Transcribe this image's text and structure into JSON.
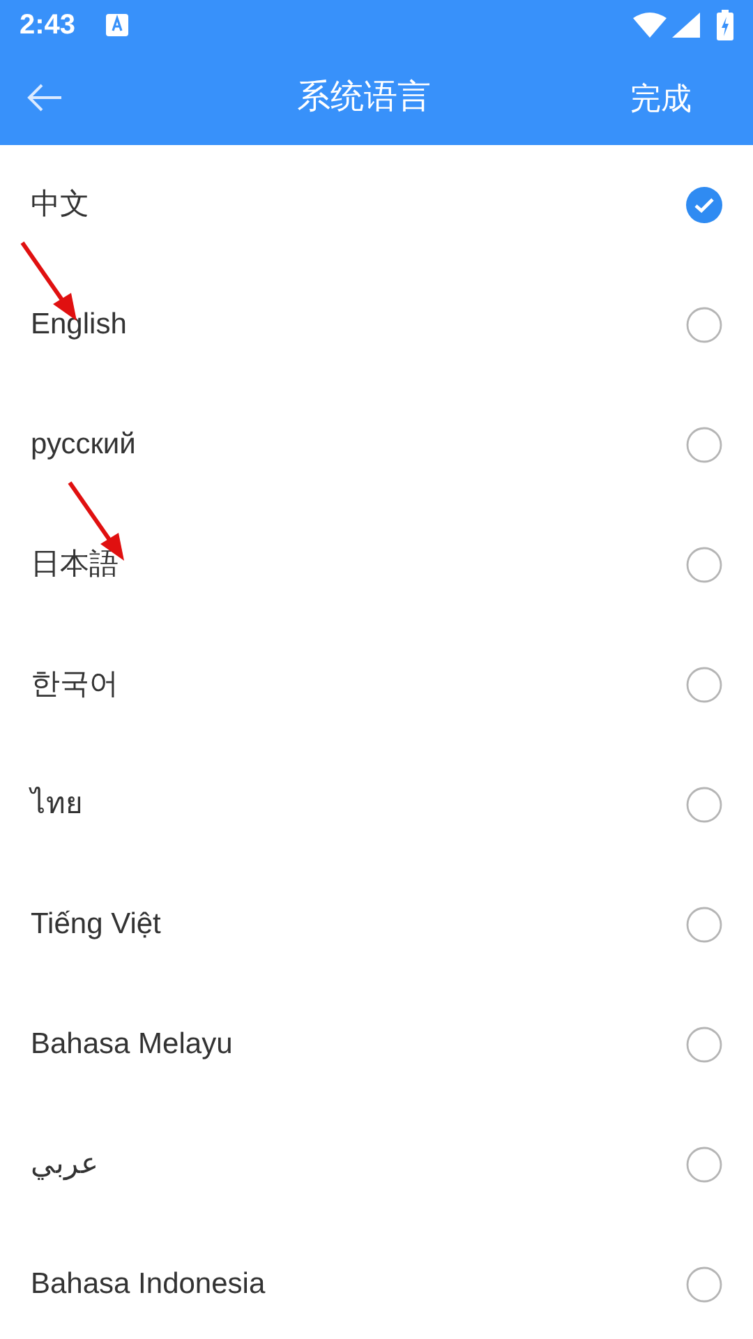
{
  "status_bar": {
    "time": "2:43"
  },
  "header": {
    "title": "系统语言",
    "action": "完成"
  },
  "languages": [
    {
      "label": "中文",
      "selected": true,
      "arrow": false
    },
    {
      "label": "English",
      "selected": false,
      "arrow": true
    },
    {
      "label": "русский",
      "selected": false,
      "arrow": false
    },
    {
      "label": "日本語",
      "selected": false,
      "arrow": true
    },
    {
      "label": "한국어",
      "selected": false,
      "arrow": false
    },
    {
      "label": "ไทย",
      "selected": false,
      "arrow": false
    },
    {
      "label": "Tiếng Việt",
      "selected": false,
      "arrow": false
    },
    {
      "label": "Bahasa Melayu",
      "selected": false,
      "arrow": false
    },
    {
      "label": "عربي",
      "selected": false,
      "arrow": false
    },
    {
      "label": "Bahasa Indonesia",
      "selected": false,
      "arrow": false
    }
  ]
}
